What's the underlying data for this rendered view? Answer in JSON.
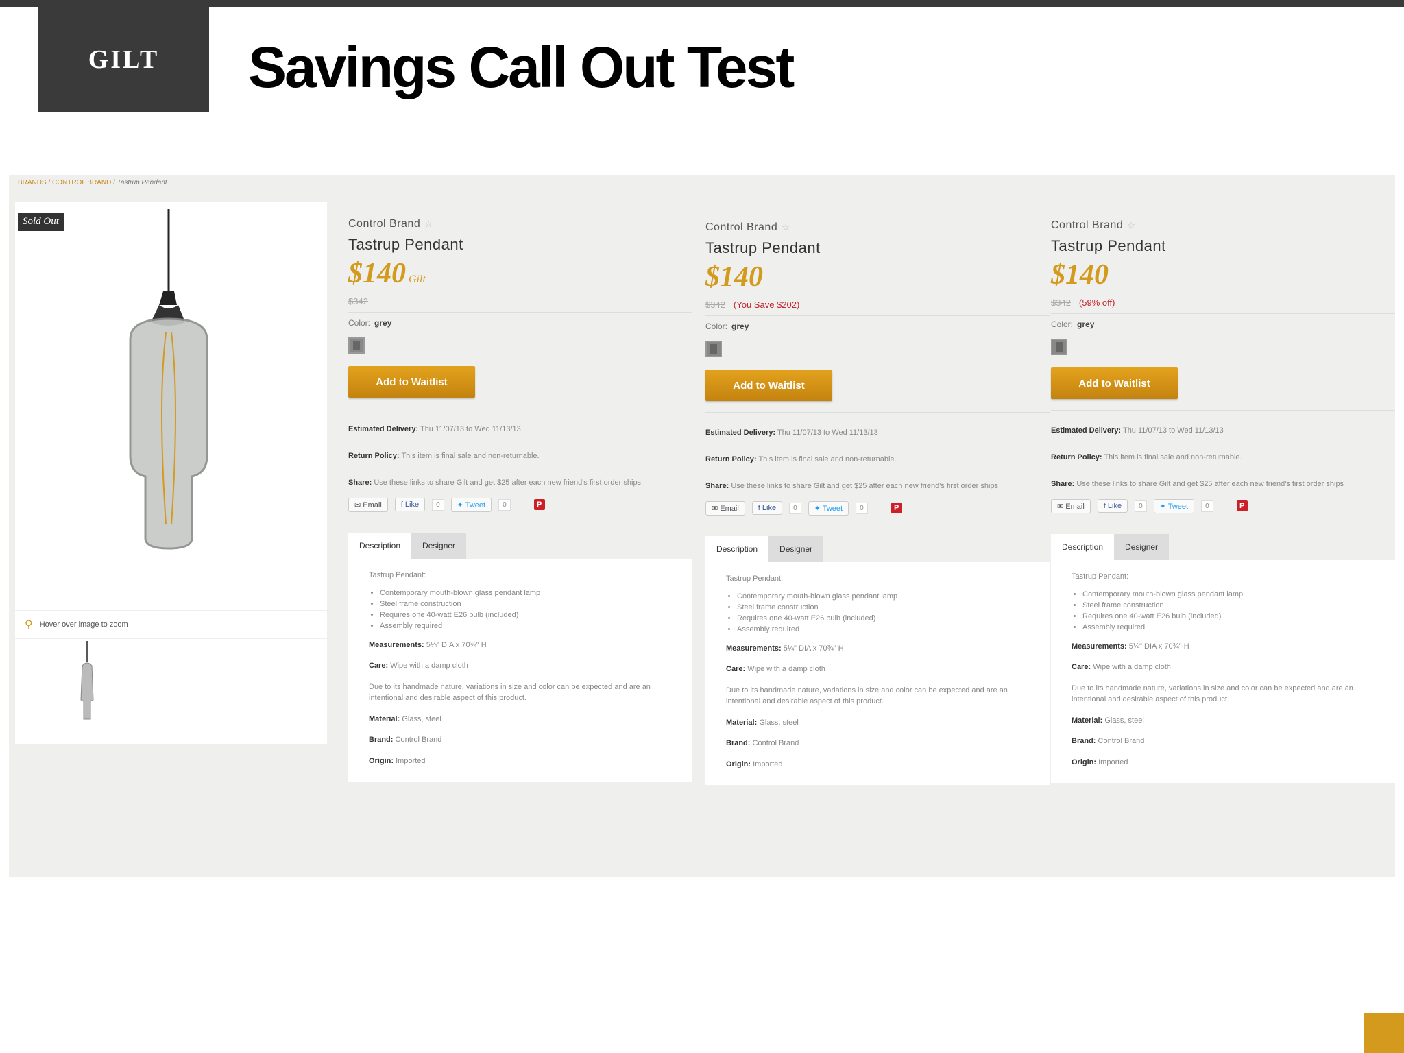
{
  "slide": {
    "logo": "GILT",
    "title": "Savings Call Out Test"
  },
  "breadcrumb": {
    "path": "BRANDS / CONTROL BRAND / ",
    "current": "Tastrup Pendant"
  },
  "gallery": {
    "badge": "Sold Out",
    "zoom_hint": "Hover over image to zoom"
  },
  "variants": [
    {
      "brand": "Control Brand",
      "product": "Tastrup Pendant",
      "price": "$140",
      "price_suffix": "Gilt",
      "old_price": "$342",
      "savings": "",
      "color_label": "Color:",
      "color_value": "grey",
      "button": "Add to Waitlist",
      "delivery_label": "Estimated Delivery:",
      "delivery_value": "Thu 11/07/13 to Wed 11/13/13",
      "return_label": "Return Policy:",
      "return_value": "This item is final sale and non-returnable.",
      "share_label": "Share:",
      "share_value": "Use these links to share Gilt and get $25 after each new friend's first order ships",
      "share_email": "Email",
      "share_like": "Like",
      "like_count": "0",
      "share_tweet": "Tweet",
      "tweet_count": "0",
      "pin_label": "P"
    },
    {
      "brand": "Control Brand",
      "product": "Tastrup Pendant",
      "price": "$140",
      "price_suffix": "",
      "old_price": "$342",
      "savings": "(You Save $202)",
      "color_label": "Color:",
      "color_value": "grey",
      "button": "Add to Waitlist",
      "delivery_label": "Estimated Delivery:",
      "delivery_value": "Thu 11/07/13 to Wed 11/13/13",
      "return_label": "Return Policy:",
      "return_value": "This item is final sale and non-returnable.",
      "share_label": "Share:",
      "share_value": "Use these links to share Gilt and get $25 after each new friend's first order ships",
      "share_email": "Email",
      "share_like": "Like",
      "like_count": "0",
      "share_tweet": "Tweet",
      "tweet_count": "0",
      "pin_label": "P"
    },
    {
      "brand": "Control Brand",
      "product": "Tastrup Pendant",
      "price": "$140",
      "price_suffix": "",
      "old_price": "$342",
      "savings": "(59% off)",
      "color_label": "Color:",
      "color_value": "grey",
      "button": "Add to Waitlist",
      "delivery_label": "Estimated Delivery:",
      "delivery_value": "Thu 11/07/13 to Wed 11/13/13",
      "return_label": "Return Policy:",
      "return_value": "This item is final sale and non-returnable.",
      "share_label": "Share:",
      "share_value": "Use these links to share Gilt and get $25 after each new friend's first order ships",
      "share_email": "Email",
      "share_like": "Like",
      "like_count": "0",
      "share_tweet": "Tweet",
      "tweet_count": "0",
      "pin_label": "P"
    }
  ],
  "description": {
    "tab_description": "Description",
    "tab_designer": "Designer",
    "product_title": "Tastrup Pendant:",
    "bullets": [
      "Contemporary mouth-blown glass pendant lamp",
      "Steel frame construction",
      "Requires one 40-watt E26 bulb (included)",
      "Assembly required"
    ],
    "measurements_label": "Measurements:",
    "measurements_value": "5¼\" DIA x 70¾\" H",
    "care_label": "Care:",
    "care_value": "Wipe with a damp cloth",
    "note": "Due to its handmade nature, variations in size and color can be expected and are an intentional and desirable aspect of this product.",
    "material_label": "Material:",
    "material_value": "Glass, steel",
    "brand_label": "Brand:",
    "brand_value": "Control Brand",
    "origin_label": "Origin:",
    "origin_value": "Imported"
  },
  "colors": {
    "accent": "#d39a1e",
    "savings_red": "#c2252d",
    "header_dark": "#3a3a3a"
  }
}
